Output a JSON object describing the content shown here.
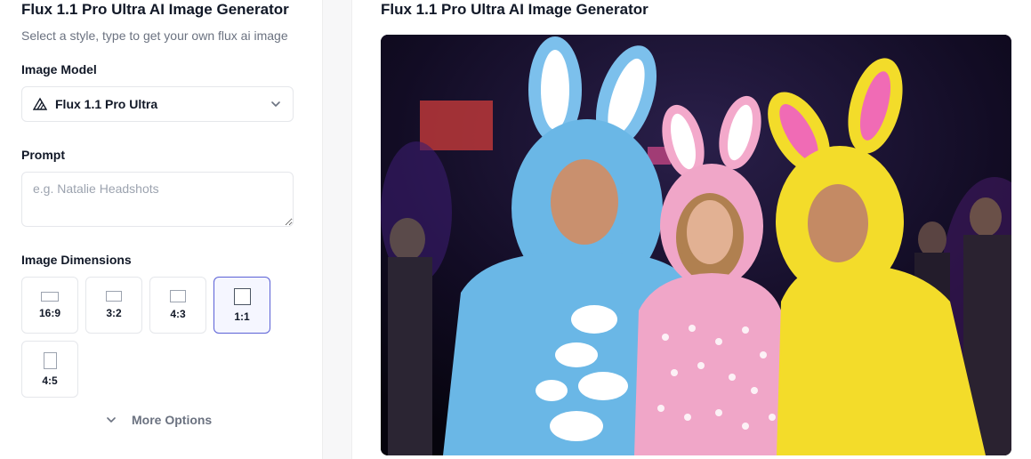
{
  "left": {
    "title": "Flux 1.1 Pro Ultra AI Image Generator",
    "subtitle": "Select a style, type to get your own flux ai image",
    "model_label": "Image Model",
    "model_value": "Flux 1.1 Pro Ultra",
    "prompt_label": "Prompt",
    "prompt_placeholder": "e.g. Natalie Headshots",
    "dimensions_label": "Image Dimensions",
    "dimensions": [
      {
        "label": "16:9",
        "selected": false
      },
      {
        "label": "3:2",
        "selected": false
      },
      {
        "label": "4:3",
        "selected": false
      },
      {
        "label": "1:1",
        "selected": true
      },
      {
        "label": "4:5",
        "selected": false
      }
    ],
    "more_options": "More Options"
  },
  "right": {
    "title": "Flux 1.1 Pro Ultra AI Image Generator",
    "image_subject": "three people in blue, pink and yellow bunny costumes at a party"
  },
  "colors": {
    "accent": "#5b61d6",
    "blue_costume": "#6ab7e6",
    "pink_costume": "#f0a6c8",
    "yellow_costume": "#f3dc2a"
  }
}
